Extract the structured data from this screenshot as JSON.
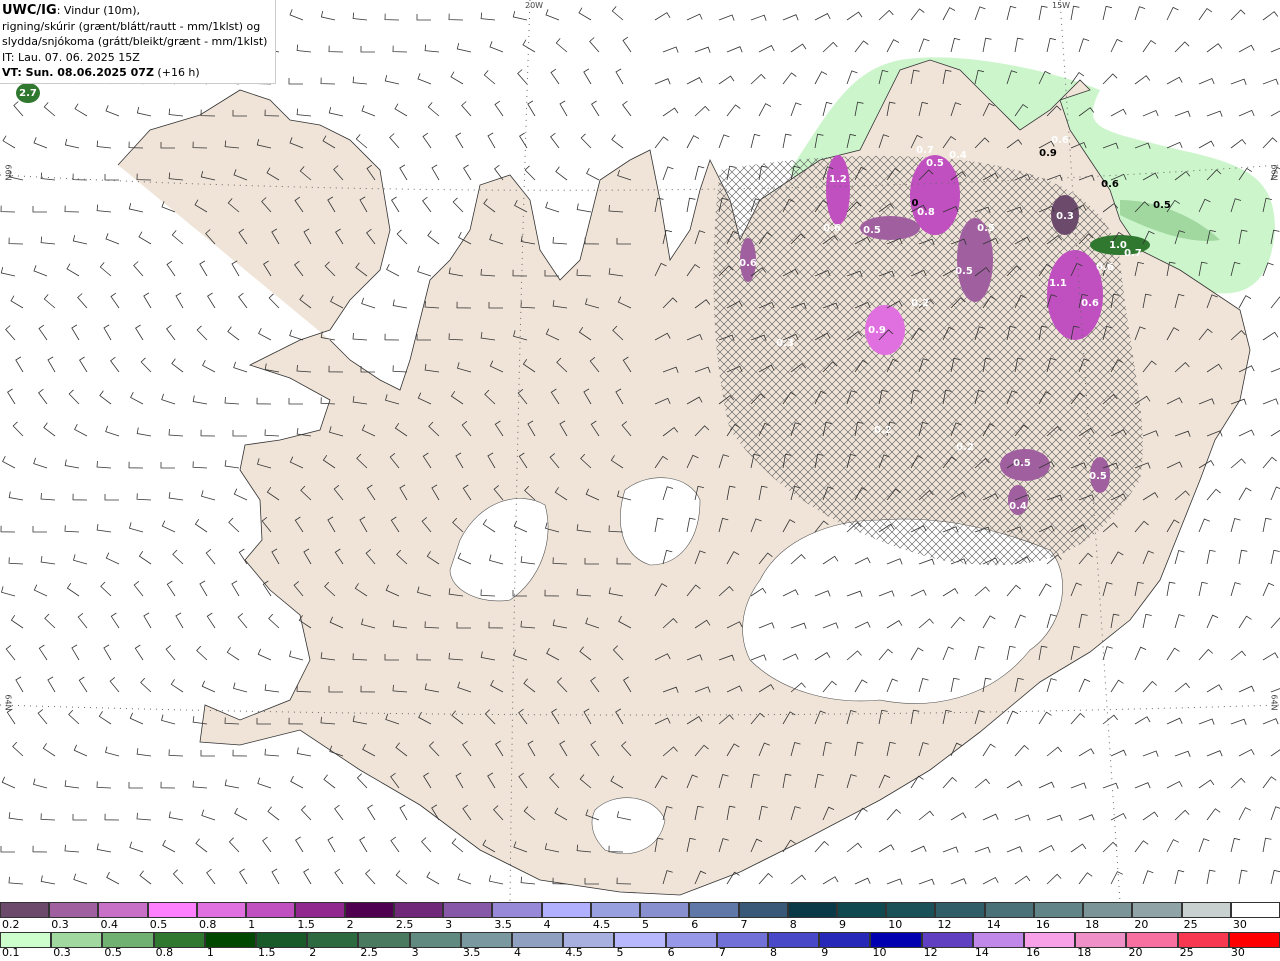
{
  "header": {
    "model": "UWC/IG",
    "line1": ": Vindur (10m),",
    "line2": "rigning/skúrir (grænt/blátt/rautt - mm/1klst) og",
    "line3": "slydda/snjókoma (grátt/bleikt/grænt - mm/1klst)",
    "issue_time": "IT: Lau. 07. 06. 2025 15Z",
    "valid_time": "VT: Sun. 08.06.2025 07Z",
    "lead": " (+16 h)"
  },
  "grid_labels": {
    "lon_20w": "20W",
    "lon_15w": "15W",
    "lat_66n_left": "66N",
    "lat_64n_left": "64N",
    "lat_66n_right": "66N",
    "lat_64n_right": "64N"
  },
  "map_values": [
    "2.7",
    "1.2",
    "0.7",
    "0.5",
    "0.4",
    "0.6",
    "0.5",
    "0",
    "0.8",
    "0.5",
    "0.6",
    "0.5",
    "0.3",
    "0.9",
    "0.6",
    "0.6",
    "0.5",
    "1.0",
    "0.7",
    "0.6",
    "1.1",
    "0.6",
    "0.9",
    "0.2",
    "0.3",
    "0.2",
    "0.5",
    "0.5",
    "0.4",
    "0.2"
  ],
  "legend_snow": {
    "labels": [
      "0.2",
      "0.3",
      "0.4",
      "0.5",
      "0.8",
      "1",
      "1.5",
      "2",
      "2.5",
      "3",
      "3.5",
      "4",
      "4.5",
      "5",
      "6",
      "7",
      "8",
      "9",
      "10",
      "12",
      "14",
      "16",
      "18",
      "20",
      "25",
      "30"
    ],
    "colors": [
      "#6b4a6b",
      "#a060a0",
      "#c870c8",
      "#ff80ff",
      "#e070e0",
      "#c050c0",
      "#902890",
      "#500050",
      "#702878",
      "#8858a8",
      "#9888d8",
      "#b0b0ff",
      "#98a0e0",
      "#8890d0",
      "#6078a8",
      "#3a5878",
      "#0a3a48",
      "#104850",
      "#1a5058",
      "#305e68",
      "#4a7078",
      "#608488",
      "#7a9498",
      "#90a4a8",
      "#c8d0d0",
      "#ffffff"
    ]
  },
  "legend_rain": {
    "labels": [
      "0.1",
      "0.3",
      "0.5",
      "0.8",
      "1",
      "1.5",
      "2",
      "2.5",
      "3",
      "3.5",
      "4",
      "4.5",
      "5",
      "6",
      "7",
      "8",
      "9",
      "10",
      "12",
      "14",
      "16",
      "18",
      "20",
      "25",
      "30"
    ],
    "colors": [
      "#ccffcc",
      "#a0d8a0",
      "#70b070",
      "#307830",
      "#004800",
      "#1a5a28",
      "#2e6a40",
      "#4a7a60",
      "#608a80",
      "#7a98a0",
      "#90a0c0",
      "#a8b0e0",
      "#b8b8ff",
      "#9898e8",
      "#7070d8",
      "#4848c8",
      "#2828b8",
      "#0000b0",
      "#6040c0",
      "#c088e8",
      "#f8a0e8",
      "#f090c8",
      "#f870a0",
      "#f83850",
      "#ff0000"
    ]
  }
}
